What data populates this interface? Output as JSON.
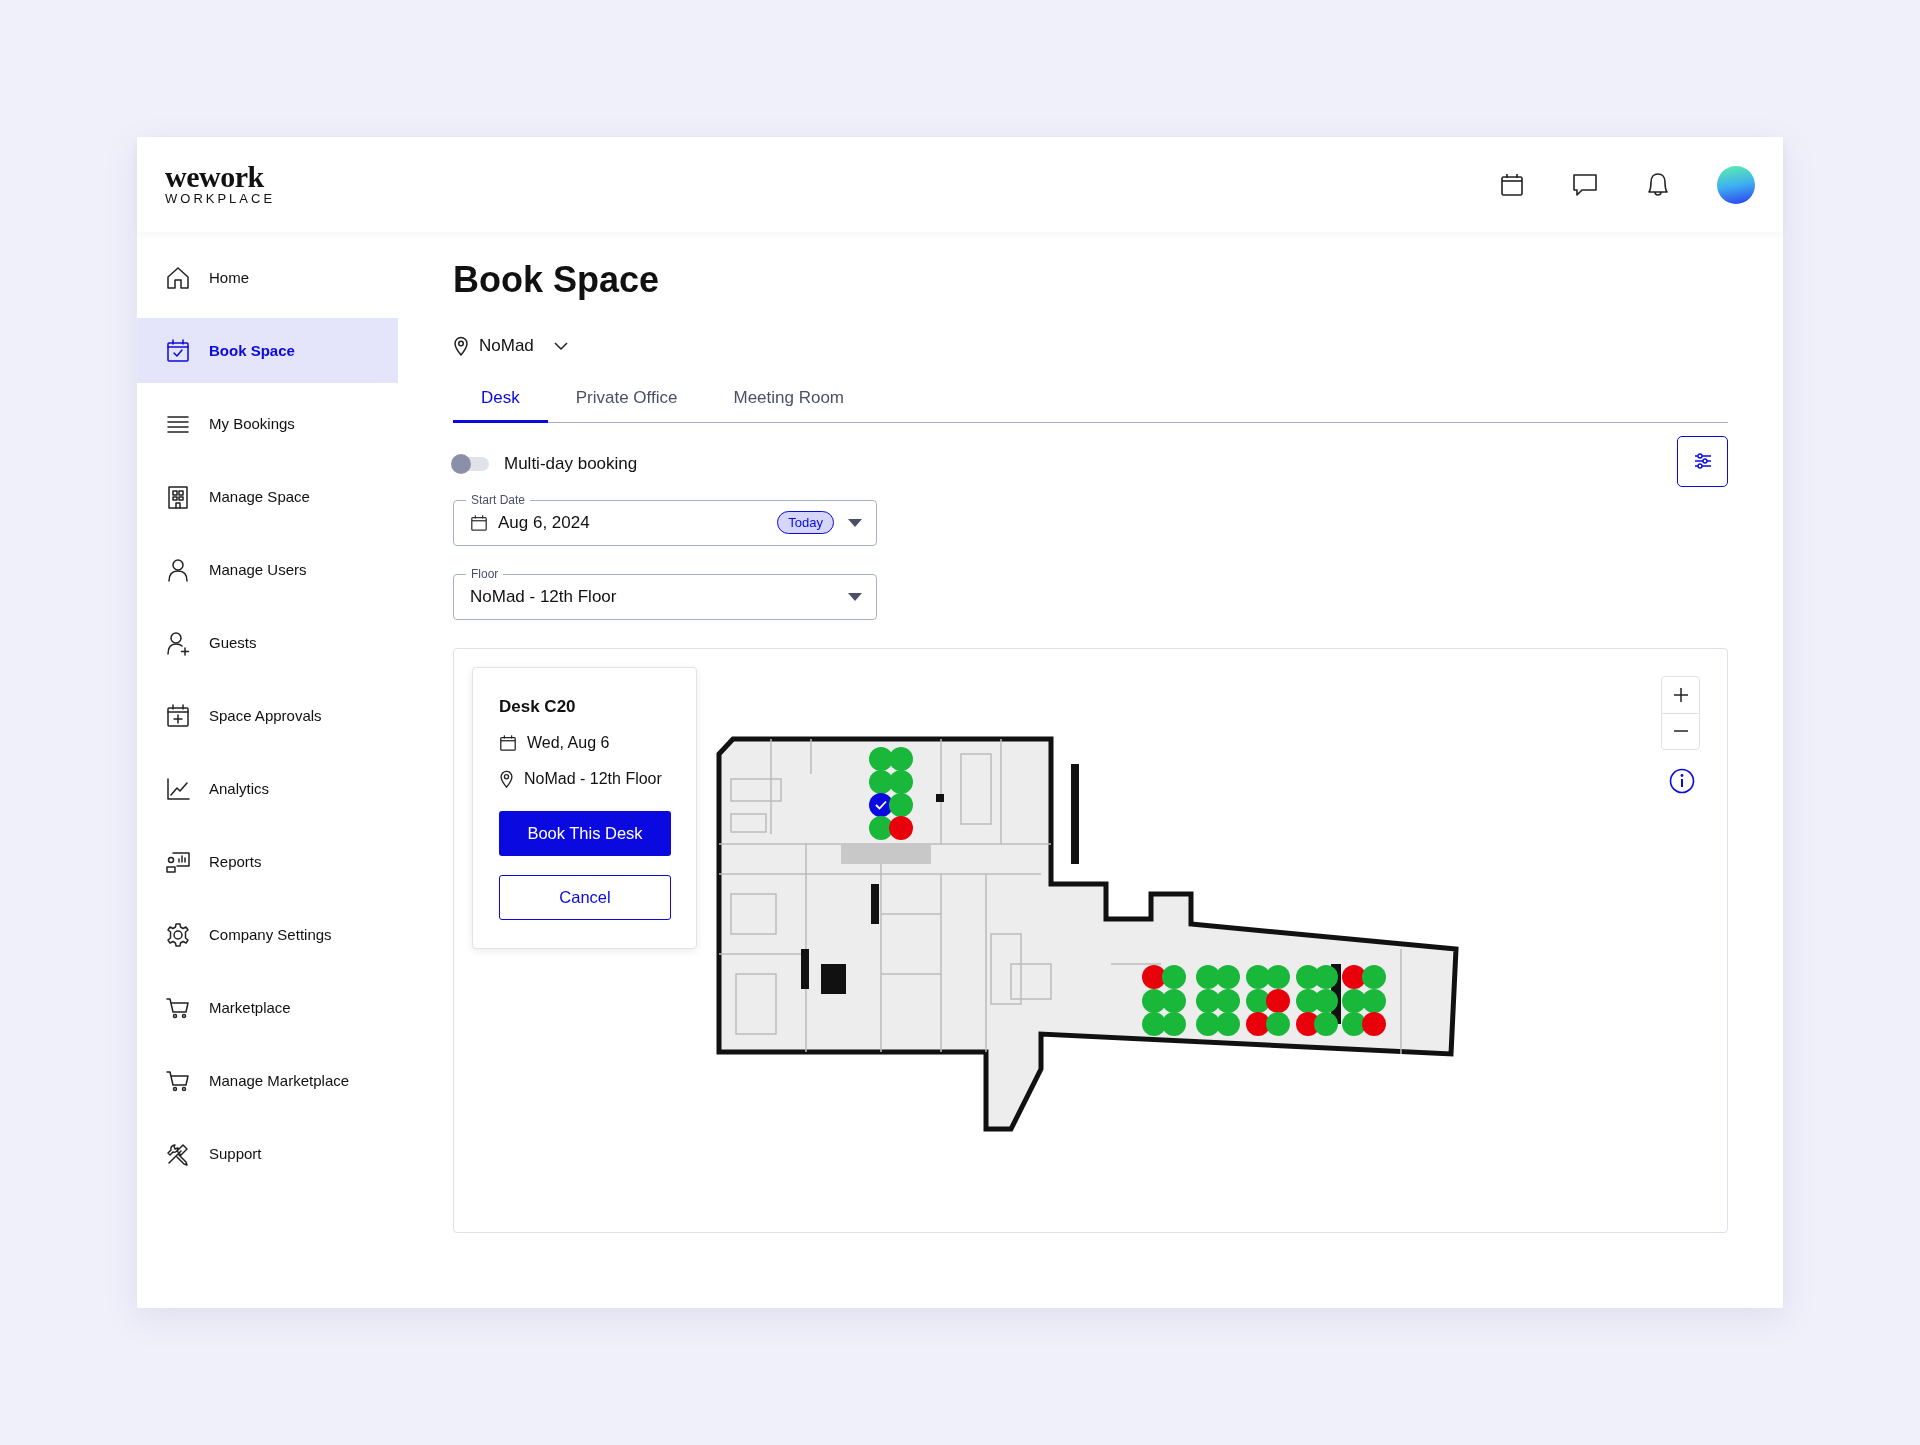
{
  "header": {
    "logo": "wework",
    "logo_sub": "WORKPLACE"
  },
  "sidebar": {
    "items": [
      {
        "label": "Home",
        "selected": false
      },
      {
        "label": "Book Space",
        "selected": true
      },
      {
        "label": "My Bookings",
        "selected": false
      },
      {
        "label": "Manage Space",
        "selected": false
      },
      {
        "label": "Manage Users",
        "selected": false
      },
      {
        "label": "Guests",
        "selected": false
      },
      {
        "label": "Space Approvals",
        "selected": false
      },
      {
        "label": "Analytics",
        "selected": false
      },
      {
        "label": "Reports",
        "selected": false
      },
      {
        "label": "Company Settings",
        "selected": false
      },
      {
        "label": "Marketplace",
        "selected": false
      },
      {
        "label": "Manage Marketplace",
        "selected": false
      },
      {
        "label": "Support",
        "selected": false
      }
    ]
  },
  "page": {
    "title": "Book Space",
    "location": "NoMad",
    "tabs": [
      {
        "label": "Desk",
        "selected": true
      },
      {
        "label": "Private Office",
        "selected": false
      },
      {
        "label": "Meeting Room",
        "selected": false
      }
    ],
    "multi_day": {
      "label": "Multi-day booking",
      "on": false
    },
    "start_date": {
      "label": "Start Date",
      "value": "Aug 6, 2024",
      "badge": "Today"
    },
    "floor": {
      "label": "Floor",
      "value": "NoMad - 12th Floor"
    }
  },
  "map": {
    "popup": {
      "title": "Desk C20",
      "date": "Wed, Aug 6",
      "location": "NoMad - 12th Floor",
      "primary_button": "Book This Desk",
      "secondary_button": "Cancel"
    },
    "desk_groups": [
      {
        "desks": [
          {
            "booked": false,
            "selected": false
          },
          {
            "booked": false,
            "selected": false
          },
          {
            "booked": false,
            "selected": true
          },
          {
            "booked": false,
            "selected": false
          },
          {
            "booked": false,
            "selected": false
          },
          {
            "booked": false,
            "selected": false
          },
          {
            "booked": false,
            "selected": false
          },
          {
            "booked": true,
            "selected": false
          }
        ]
      },
      {
        "desks": [
          {
            "booked": true,
            "selected": false
          },
          {
            "booked": false,
            "selected": false
          },
          {
            "booked": false,
            "selected": false
          },
          {
            "booked": false,
            "selected": false
          },
          {
            "booked": false,
            "selected": false
          },
          {
            "booked": false,
            "selected": false
          }
        ]
      },
      {
        "desks": [
          {
            "booked": false,
            "selected": false
          },
          {
            "booked": false,
            "selected": false
          },
          {
            "booked": false,
            "selected": false
          },
          {
            "booked": false,
            "selected": false
          },
          {
            "booked": false,
            "selected": false
          },
          {
            "booked": false,
            "selected": false
          }
        ]
      },
      {
        "desks": [
          {
            "booked": false,
            "selected": false
          },
          {
            "booked": false,
            "selected": false
          },
          {
            "booked": true,
            "selected": false
          },
          {
            "booked": false,
            "selected": false
          },
          {
            "booked": true,
            "selected": false
          },
          {
            "booked": false,
            "selected": false
          }
        ]
      },
      {
        "desks": [
          {
            "booked": false,
            "selected": false
          },
          {
            "booked": false,
            "selected": false
          },
          {
            "booked": true,
            "selected": false
          },
          {
            "booked": false,
            "selected": false
          },
          {
            "booked": false,
            "selected": false
          },
          {
            "booked": false,
            "selected": false
          }
        ]
      },
      {
        "desks": [
          {
            "booked": true,
            "selected": false
          },
          {
            "booked": false,
            "selected": false
          },
          {
            "booked": false,
            "selected": false
          },
          {
            "booked": false,
            "selected": false
          },
          {
            "booked": false,
            "selected": false
          },
          {
            "booked": true,
            "selected": false
          }
        ]
      }
    ]
  }
}
